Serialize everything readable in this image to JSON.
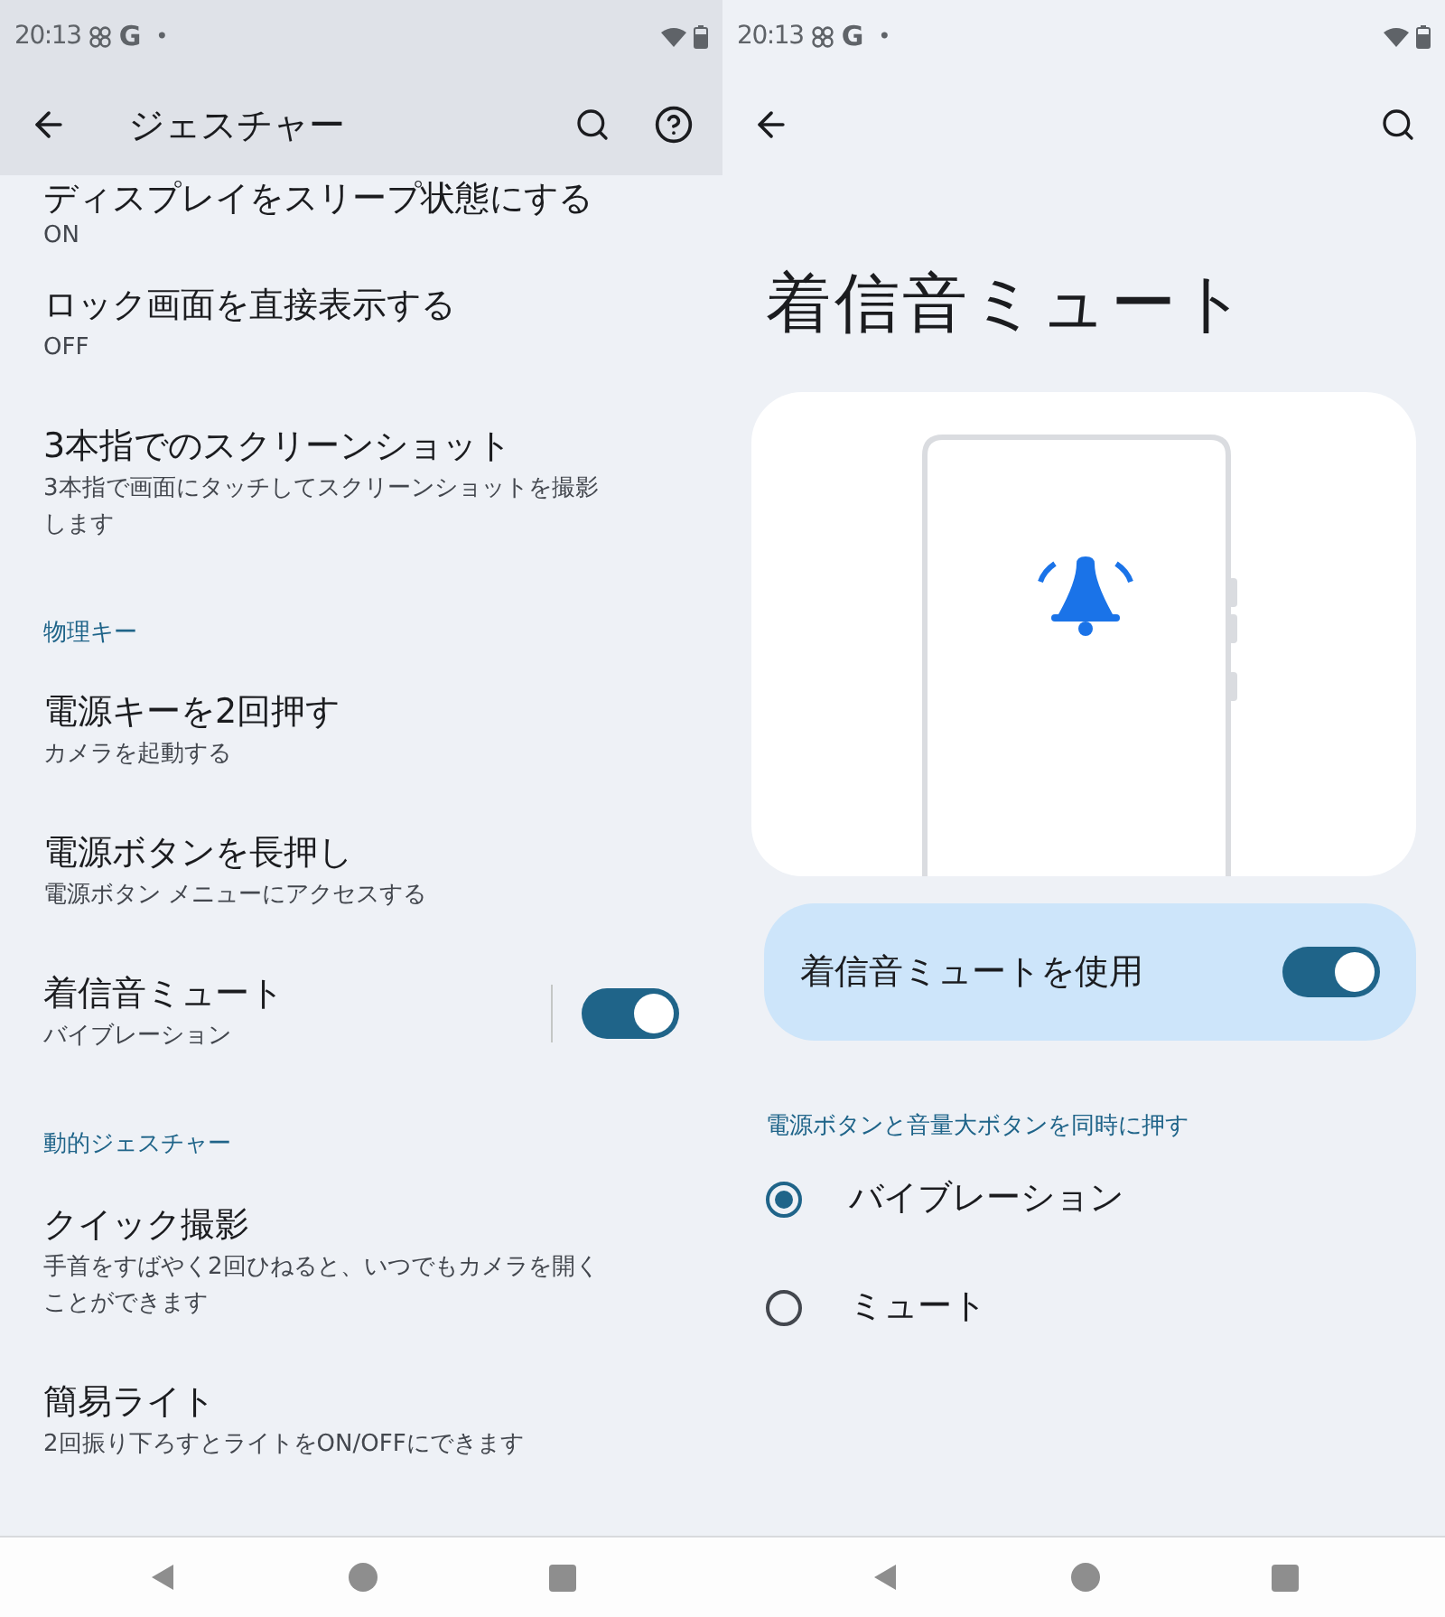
{
  "left": {
    "status_bar": {
      "time": "20:13",
      "g": "G",
      "dot": "•"
    },
    "toolbar": {
      "title": "ジェスチャー"
    },
    "partial_item": {
      "title": "ディスプレイをスリープ状態にする",
      "summary": "ON"
    },
    "sections": [
      {
        "items": [
          {
            "title": "ロック画面を直接表示する",
            "summary": "OFF"
          },
          {
            "title": "3本指でのスクリーンショット",
            "summary": "3本指で画面にタッチしてスクリーンショットを撮影します"
          }
        ]
      },
      {
        "header": "物理キー",
        "items": [
          {
            "title": "電源キーを2回押す",
            "summary": "カメラを起動する"
          },
          {
            "title": "電源ボタンを長押し",
            "summary": "電源ボタン メニューにアクセスする"
          },
          {
            "title": "着信音ミュート",
            "summary": "バイブレーション",
            "kind": "switch",
            "on": true
          }
        ]
      },
      {
        "header": "動的ジェスチャー",
        "items": [
          {
            "title": "クイック撮影",
            "summary": "手首をすばやく2回ひねると、いつでもカメラを開くことができます"
          },
          {
            "title": "簡易ライト",
            "summary": "2回振り下ろすとライトをON/OFFにできます"
          }
        ]
      }
    ]
  },
  "right": {
    "status_bar": {
      "time": "20:13",
      "g": "G",
      "dot": "•"
    },
    "title": "着信音ミュート",
    "main_switch": {
      "label": "着信音ミュートを使用",
      "on": true
    },
    "radio_group": {
      "header": "電源ボタンと音量大ボタンを同時に押す",
      "options": [
        {
          "label": "バイブレーション",
          "selected": true
        },
        {
          "label": "ミュート",
          "selected": false
        }
      ]
    }
  }
}
